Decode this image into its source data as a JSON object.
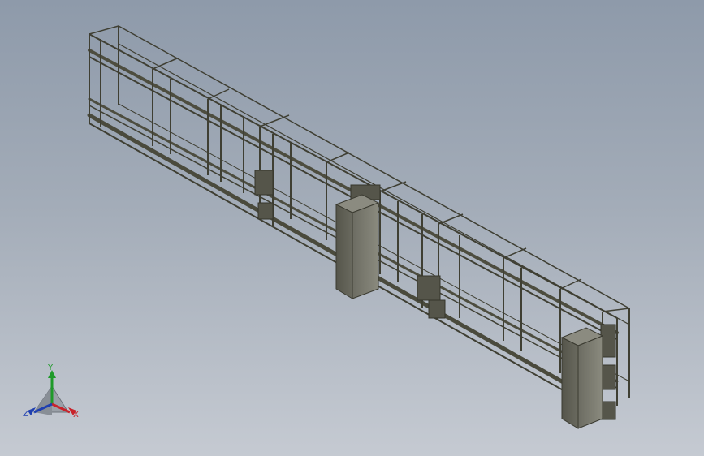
{
  "viewport": {
    "background_top": "#8e9aaa",
    "background_bottom": "#c5cad2"
  },
  "model": {
    "frame_color": "#4a4a3c",
    "cabinet_color": "#77776c"
  },
  "triad": {
    "x_label": "X",
    "y_label": "Y",
    "z_label": "Z",
    "x_color": "#c8232b",
    "y_color": "#1f9a2a",
    "z_color": "#1f3fb0"
  }
}
